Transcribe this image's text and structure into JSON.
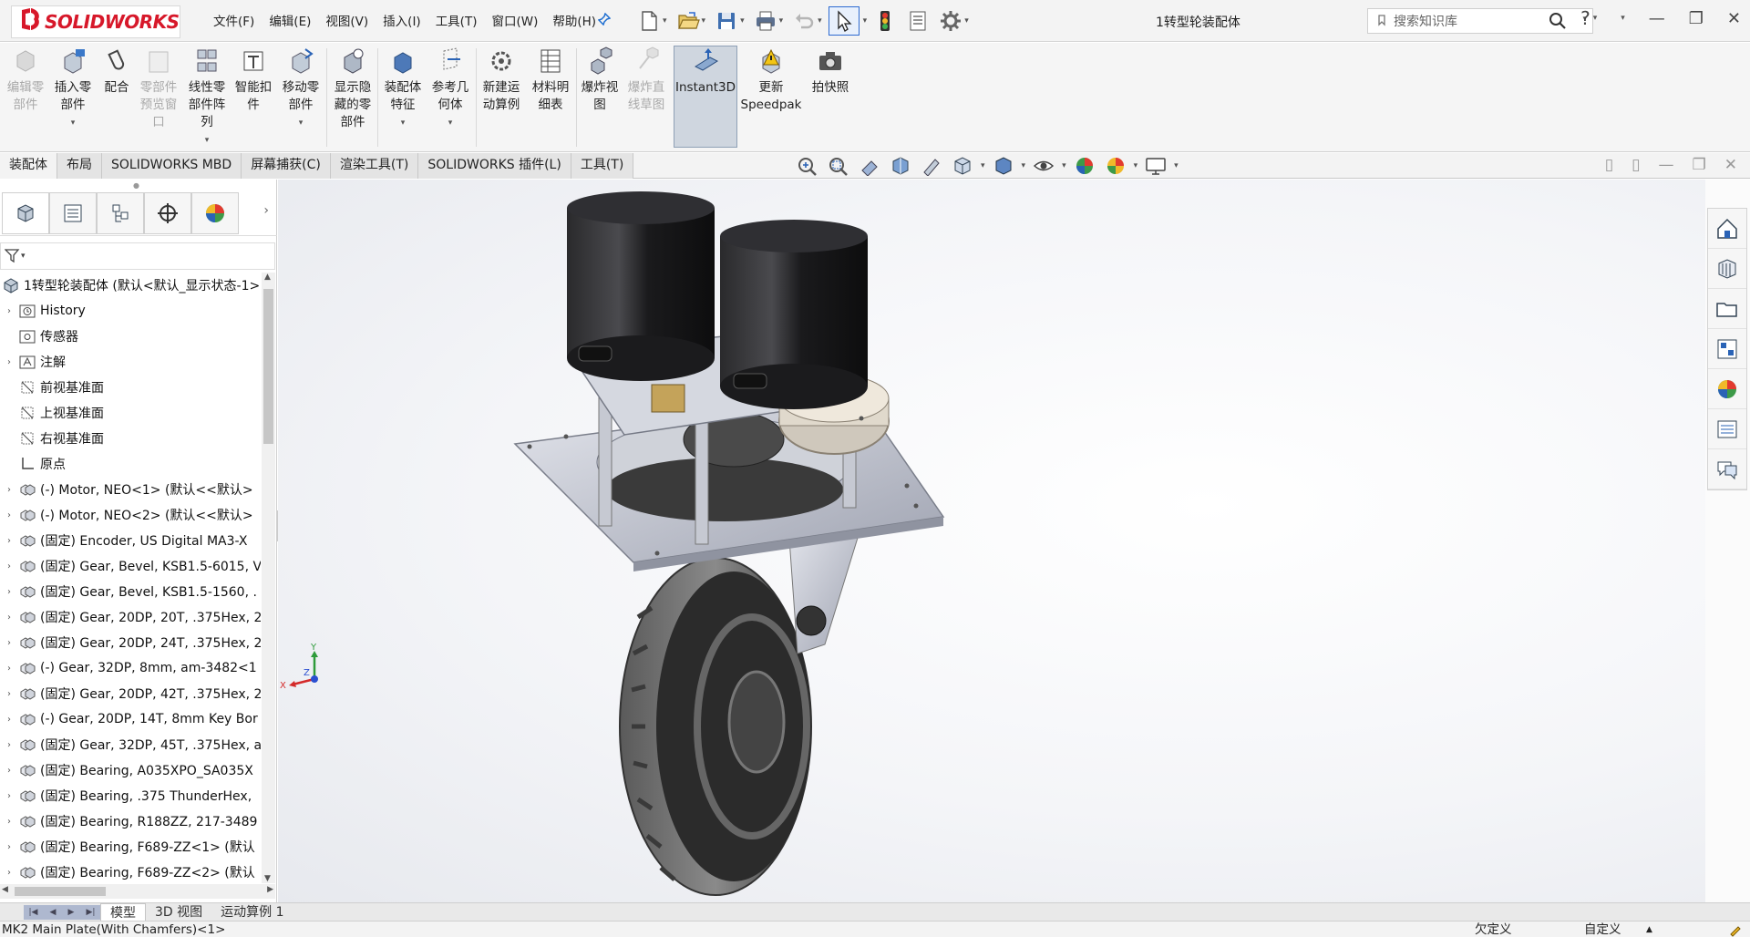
{
  "app": {
    "brand": "SOLIDWORKS",
    "doc_title": "1转型轮装配体",
    "search_placeholder": "搜索知识库",
    "help": "?"
  },
  "menu": [
    "文件(F)",
    "编辑(E)",
    "视图(V)",
    "插入(I)",
    "工具(T)",
    "窗口(W)",
    "帮助(H)"
  ],
  "commands": [
    {
      "label": "编辑零\n部件",
      "enabled": false,
      "dropdown": false,
      "icon": "edit-component-icon"
    },
    {
      "label": "插入零\n部件",
      "enabled": true,
      "dropdown": true,
      "icon": "insert-component-icon"
    },
    {
      "label": "配合",
      "enabled": true,
      "dropdown": false,
      "icon": "mate-icon"
    },
    {
      "label": "零部件\n预览窗\n口",
      "enabled": false,
      "dropdown": false,
      "icon": "component-preview-icon"
    },
    {
      "label": "线性零\n部件阵\n列",
      "enabled": true,
      "dropdown": true,
      "icon": "linear-pattern-icon"
    },
    {
      "label": "智能扣\n件",
      "enabled": true,
      "dropdown": false,
      "icon": "smart-fastener-icon"
    },
    {
      "label": "移动零\n部件",
      "enabled": true,
      "dropdown": true,
      "icon": "move-component-icon"
    },
    {
      "label": "显示隐\n藏的零\n部件",
      "enabled": true,
      "dropdown": false,
      "icon": "show-hidden-icon"
    },
    {
      "label": "装配体\n特征",
      "enabled": true,
      "dropdown": true,
      "icon": "assembly-feature-icon"
    },
    {
      "label": "参考几\n何体",
      "enabled": true,
      "dropdown": true,
      "icon": "reference-geometry-icon"
    },
    {
      "label": "新建运\n动算例",
      "enabled": true,
      "dropdown": false,
      "icon": "new-motion-study-icon"
    },
    {
      "label": "材料明\n细表",
      "enabled": true,
      "dropdown": false,
      "icon": "bom-icon"
    },
    {
      "label": "爆炸视\n图",
      "enabled": true,
      "dropdown": false,
      "icon": "exploded-view-icon"
    },
    {
      "label": "爆炸直\n线草图",
      "enabled": false,
      "dropdown": false,
      "icon": "explode-line-icon"
    },
    {
      "label": "Instant3D",
      "enabled": true,
      "dropdown": false,
      "active": true,
      "icon": "instant3d-icon"
    },
    {
      "label": "更新\nSpeedpak",
      "enabled": true,
      "dropdown": false,
      "icon": "speedpak-icon"
    },
    {
      "label": "拍快照",
      "enabled": true,
      "dropdown": false,
      "icon": "snapshot-icon"
    }
  ],
  "tabs": [
    "装配体",
    "布局",
    "SOLIDWORKS MBD",
    "屏幕捕获(C)",
    "渲染工具(T)",
    "SOLIDWORKS 插件(L)",
    "工具(T)"
  ],
  "tree": [
    {
      "text": "1转型轮装配体  (默认<默认_显示状态-1>)",
      "twisty": "",
      "icon": "assembly-icon"
    },
    {
      "text": "History",
      "twisty": "›",
      "icon": "history-icon"
    },
    {
      "text": "传感器",
      "twisty": "",
      "icon": "sensor-icon"
    },
    {
      "text": "注解",
      "twisty": "›",
      "icon": "annotation-icon"
    },
    {
      "text": "前视基准面",
      "twisty": "",
      "icon": "plane-icon"
    },
    {
      "text": "上视基准面",
      "twisty": "",
      "icon": "plane-icon"
    },
    {
      "text": "右视基准面",
      "twisty": "",
      "icon": "plane-icon"
    },
    {
      "text": "原点",
      "twisty": "",
      "icon": "origin-icon"
    },
    {
      "text": "(-) Motor, NEO<1> (默认<<默认>",
      "twisty": "›",
      "icon": "subassembly-icon"
    },
    {
      "text": "(-) Motor, NEO<2> (默认<<默认>",
      "twisty": "›",
      "icon": "subassembly-icon"
    },
    {
      "text": "(固定) Encoder, US Digital MA3-X",
      "twisty": "›",
      "icon": "subassembly-icon"
    },
    {
      "text": "(固定) Gear, Bevel, KSB1.5-6015, V",
      "twisty": "›",
      "icon": "subassembly-icon"
    },
    {
      "text": "(固定) Gear, Bevel, KSB1.5-1560, .",
      "twisty": "›",
      "icon": "subassembly-icon"
    },
    {
      "text": "(固定) Gear, 20DP, 20T, .375Hex, 2",
      "twisty": "›",
      "icon": "subassembly-icon"
    },
    {
      "text": "(固定) Gear, 20DP, 24T, .375Hex, 2",
      "twisty": "›",
      "icon": "subassembly-icon"
    },
    {
      "text": "(-) Gear, 32DP, 8mm, am-3482<1",
      "twisty": "›",
      "icon": "subassembly-icon"
    },
    {
      "text": "(固定) Gear, 20DP, 42T, .375Hex, 2",
      "twisty": "›",
      "icon": "subassembly-icon"
    },
    {
      "text": "(-) Gear, 20DP, 14T, 8mm Key Bor",
      "twisty": "›",
      "icon": "subassembly-icon"
    },
    {
      "text": "(固定) Gear, 32DP, 45T, .375Hex, a",
      "twisty": "›",
      "icon": "subassembly-icon"
    },
    {
      "text": "(固定) Bearing, A035XPO_SA035X",
      "twisty": "›",
      "icon": "subassembly-icon"
    },
    {
      "text": "(固定) Bearing, .375 ThunderHex,",
      "twisty": "›",
      "icon": "subassembly-icon"
    },
    {
      "text": "(固定) Bearing, R188ZZ, 217-3489",
      "twisty": "›",
      "icon": "subassembly-icon"
    },
    {
      "text": "(固定) Bearing, F689-ZZ<1> (默认",
      "twisty": "›",
      "icon": "subassembly-icon"
    },
    {
      "text": "(固定) Bearing, F689-ZZ<2> (默认",
      "twisty": "›",
      "icon": "subassembly-icon"
    }
  ],
  "bottom_tabs": [
    "模型",
    "3D 视图",
    "运动算例 1"
  ],
  "status": {
    "selection": "MK2 Main Plate(With Chamfers)<1>",
    "state": "欠定义",
    "units": "自定义"
  },
  "triad": {
    "x": "X",
    "y": "Y",
    "z": "Z"
  },
  "colors": {
    "brand_red": "#d7182a",
    "accent_blue": "#2d6ad1",
    "motor_black": "#1c1c1e",
    "aluminum": "#c9ccd4"
  }
}
